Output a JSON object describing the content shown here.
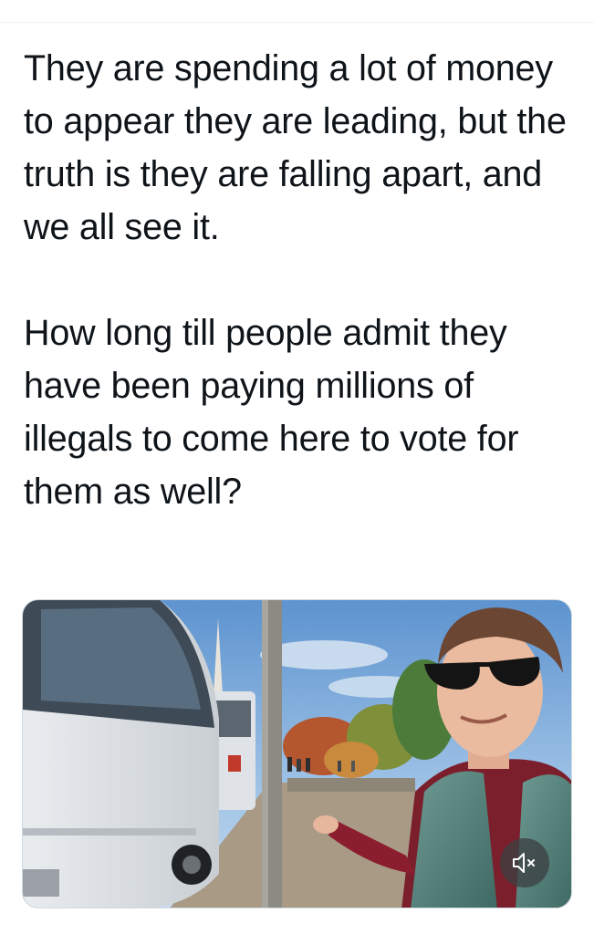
{
  "tweet": {
    "paragraph_1": "They are spending a lot of money to appear they are leading, but the truth is they are falling apart, and we all see it.",
    "paragraph_2": "How long till people admit they have been paying millions of illegals to come here to vote for them as well?"
  },
  "media": {
    "type": "video",
    "content": "man in sunglasses and green vest standing beside white buses on a street with a monument in background",
    "mute_icon": "speaker-muted-icon"
  },
  "colors": {
    "text": "#0f1419",
    "divider": "#eff3f4",
    "media_border": "#cfd9de",
    "mute_bg": "#3c4043"
  }
}
